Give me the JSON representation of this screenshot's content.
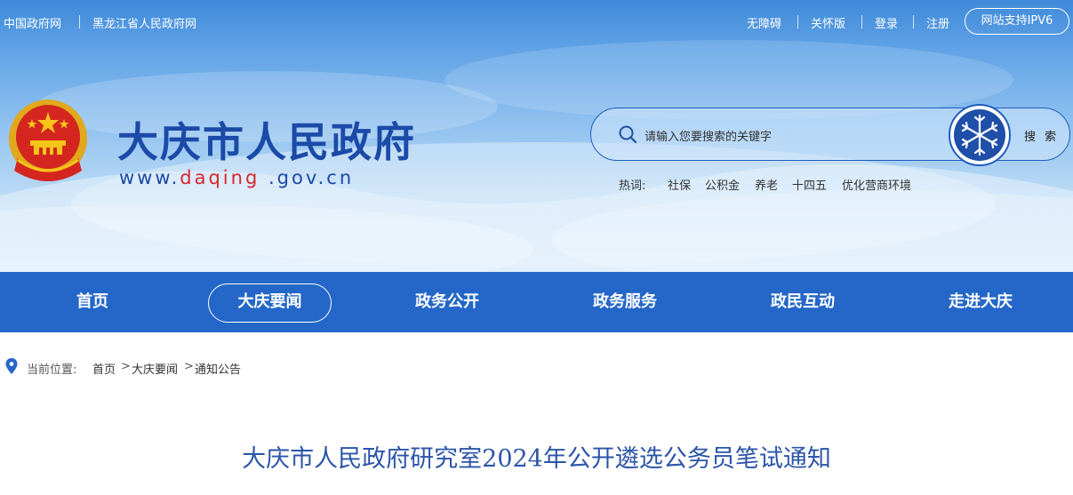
{
  "topbar": {
    "left_links": [
      "中国政府网",
      "黑龙江省人民政府网"
    ],
    "right_links": [
      "无障碍",
      "关怀版",
      "登录",
      "注册"
    ],
    "ipv6_label": "网站支持IPV6"
  },
  "header": {
    "site_title": "大庆市人民政府",
    "url_prefix": "www.",
    "url_highlight": "daqing",
    "url_suffix": " .gov.cn"
  },
  "search": {
    "placeholder": "请输入您要搜索的关键字",
    "button_label": "搜 索",
    "hot_label": "热词:",
    "hot_words": [
      "社保",
      "公积金",
      "养老",
      "十四五",
      "优化营商环境"
    ]
  },
  "nav": {
    "items": [
      "首页",
      "大庆要闻",
      "政务公开",
      "政务服务",
      "政民互动",
      "走进大庆"
    ],
    "active": "大庆要闻"
  },
  "breadcrumb": {
    "label": "当前位置:",
    "items": [
      "首页",
      "大庆要闻",
      "通知公告"
    ],
    "separator": ">"
  },
  "article": {
    "title": "大庆市人民政府研究室2024年公开遴选公务员笔试通知"
  },
  "colors": {
    "nav_bg": "#2467c8",
    "brand_blue": "#1b4aa8",
    "url_red": "#d9262d",
    "title_blue": "#2c55a8"
  },
  "icons": [
    "national-emblem-icon",
    "search-icon",
    "snowflake-icon",
    "location-pin-icon"
  ]
}
